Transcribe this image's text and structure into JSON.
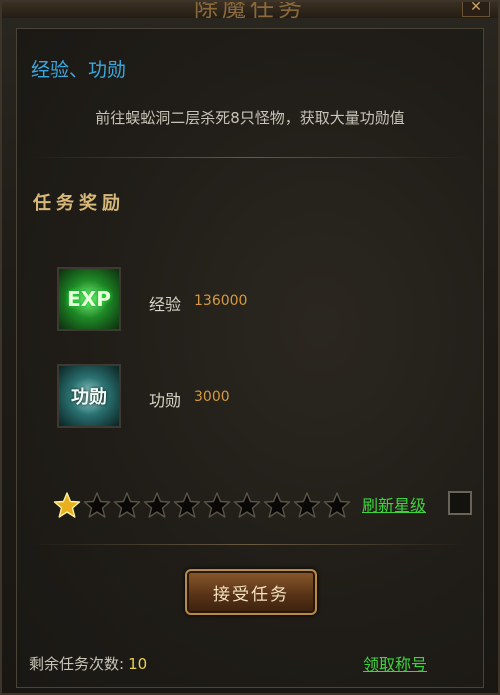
{
  "window": {
    "title": "除魔任务",
    "close_label": "✕"
  },
  "quest": {
    "name": "经验、功勋",
    "description": "前往蜈蚣洞二层杀死8只怪物，获取大量功勋值"
  },
  "rewards_section": {
    "title": "任务奖励",
    "items": [
      {
        "icon": "exp-icon",
        "icon_text": "EXP",
        "label": "经验",
        "value": "136000"
      },
      {
        "icon": "merit-icon",
        "icon_text": "功勋",
        "label": "功勋",
        "value": "3000"
      }
    ]
  },
  "star_rating": {
    "filled": 1,
    "total": 10,
    "filled_color": "#e8b020",
    "empty_color": "#0a0806"
  },
  "actions": {
    "refresh_stars": "刷新星级",
    "accept": "接受任务",
    "claim_title": "领取称号"
  },
  "remaining": {
    "label": "剩余任务次数:",
    "count": "10"
  },
  "colors": {
    "link_green": "#3ed43e",
    "quest_blue": "#3aa8e0",
    "reward_orange": "#d89a40"
  }
}
